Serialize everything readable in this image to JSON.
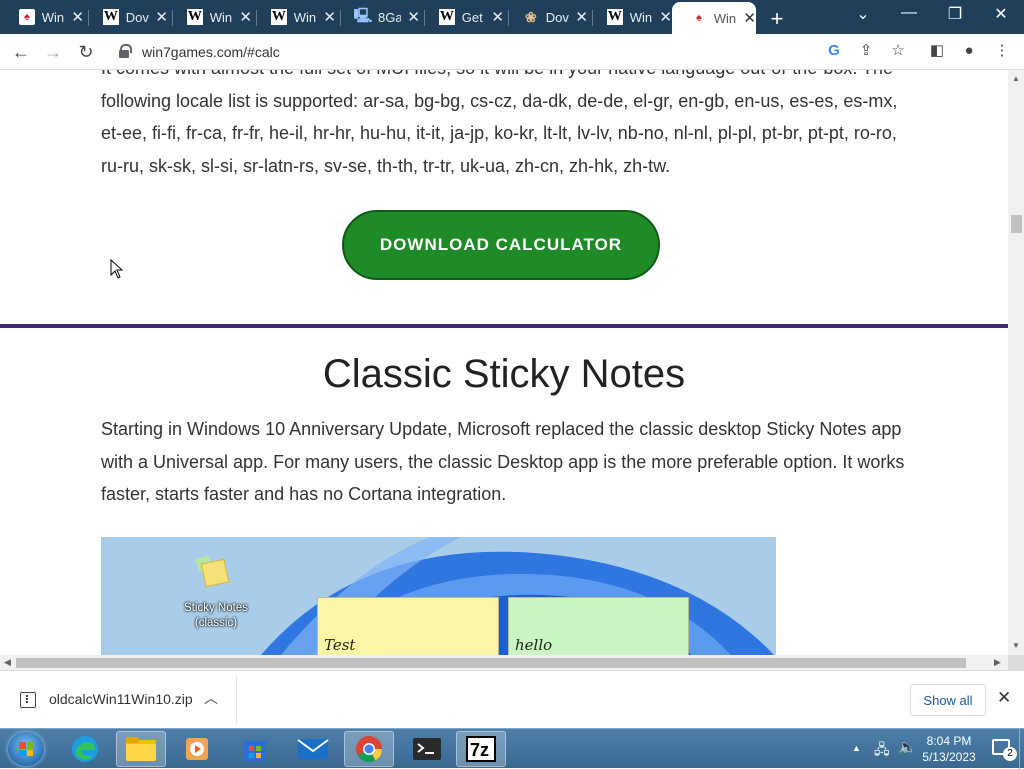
{
  "browser": {
    "tabs": [
      {
        "icon": "red-app-icon",
        "title": "Win"
      },
      {
        "icon": "wikipedia-w-icon",
        "title": "Dov"
      },
      {
        "icon": "wikipedia-w-icon",
        "title": "Win"
      },
      {
        "icon": "wikipedia-w-icon",
        "title": "Win"
      },
      {
        "icon": "computer-icon",
        "title": "8Ga"
      },
      {
        "icon": "wikipedia-w-icon",
        "title": "Get"
      },
      {
        "icon": "shell-icon",
        "title": "Dov"
      },
      {
        "icon": "wikipedia-w-icon",
        "title": "Win"
      },
      {
        "icon": "red-app-icon",
        "title": "Win",
        "active": true
      }
    ],
    "url": "win7games.com/#calc"
  },
  "page": {
    "intro_partial": "It comes with almost the full set of MUI files, so it will be in your native language out-of-the-box. The following locale list is supported: ar-sa, bg-bg, cs-cz, da-dk, de-de, el-gr, en-gb, en-us, es-es, es-mx, et-ee, fi-fi, fr-ca, fr-fr, he-il, hr-hr, hu-hu, it-it, ja-jp, ko-kr, lt-lt, lv-lv, nb-no, nl-nl, pl-pl, pt-br, pt-pt, ro-ro, ru-ru, sk-sk, sl-si, sr-latn-rs, sv-se, th-th, tr-tr, uk-ua, zh-cn, zh-hk, zh-tw.",
    "download_button": "DOWNLOAD CALCULATOR",
    "section_title": "Classic Sticky Notes",
    "section_text": "Starting in Windows 10 Anniversary Update, Microsoft replaced the classic desktop Sticky Notes app with a Universal app. For many users, the classic Desktop app is the more preferable option. It works faster, starts faster and has no Cortana integration.",
    "screenshot": {
      "icon_label": "Sticky Notes (classic)",
      "note1": "Test",
      "note2": "hello",
      "note1_color": "#fbf6a5",
      "note2_color": "#c9f5c0"
    }
  },
  "downloads": {
    "file_name": "oldcalcWin11Win10.zip",
    "show_all": "Show all"
  },
  "taskbar": {
    "pinned": [
      "edge-icon",
      "explorer-icon",
      "media-player-icon",
      "store-icon",
      "mail-icon",
      "chrome-icon",
      "terminal-icon",
      "7zip-icon"
    ],
    "time": "8:04 PM",
    "date": "5/13/2023",
    "notification_count": "2"
  },
  "colors": {
    "tabstrip": "#1f3f5a",
    "download_button": "#1e8a28",
    "divider": "#4a2775"
  }
}
